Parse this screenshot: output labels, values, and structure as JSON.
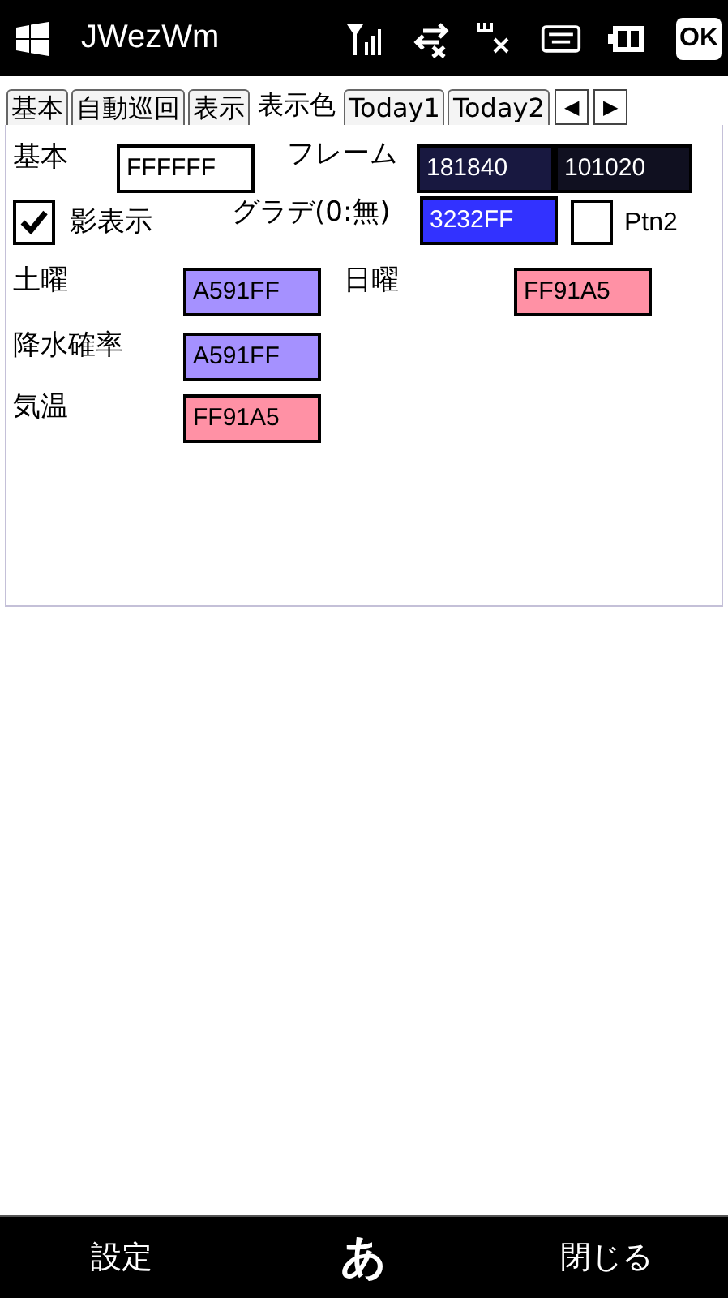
{
  "top_bar": {
    "title": "JWezWm",
    "ok_button": "OK"
  },
  "tabs": [
    {
      "label": "基本",
      "selected": false
    },
    {
      "label": "自動巡回",
      "selected": false
    },
    {
      "label": "表示",
      "selected": false
    },
    {
      "label": "表示色",
      "selected": true
    },
    {
      "label": "Today1",
      "selected": false
    },
    {
      "label": "Today2",
      "selected": false
    }
  ],
  "tab_scroll": [
    "◀",
    "▶"
  ],
  "basic": {
    "label": "基本",
    "value": "FFFFFF",
    "color": "#ffffff"
  },
  "frame": {
    "label": "フレーム",
    "fields": [
      {
        "value": "181840",
        "color": "#181840"
      },
      {
        "value": "101020",
        "color": "#101020"
      }
    ]
  },
  "shadow": {
    "label": "影表示",
    "checked": true
  },
  "gradient": {
    "label": "グラデ(0:無)",
    "value": "3232FF",
    "color": "#3232ff"
  },
  "ptn2": {
    "label": "Ptn2",
    "checked": false
  },
  "saturday": {
    "label": "土曜",
    "value": "A591FF",
    "color": "#a591ff"
  },
  "sunday": {
    "label": "日曜",
    "value": "FF91A5",
    "color": "#ff91a5"
  },
  "precipitation": {
    "label": "降水確率",
    "value": "A591FF",
    "color": "#a591ff"
  },
  "temperature": {
    "label": "気温",
    "value": "FF91A5",
    "color": "#ff91a5"
  },
  "soft_keys": {
    "left": "設定",
    "center": "あ",
    "right": "閉じる"
  }
}
